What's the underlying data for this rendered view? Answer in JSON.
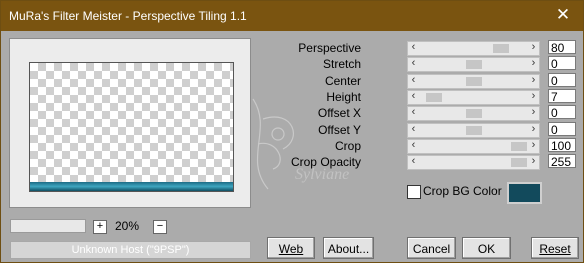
{
  "window": {
    "title": "MuRa's Filter Meister - Perspective Tiling 1.1",
    "close_icon": "close-icon"
  },
  "preview": {
    "zoom": "20%",
    "plus": "+",
    "minus": "−",
    "host_text": "Unknown Host (\"9PSP\")"
  },
  "params": [
    {
      "label": "Perspective",
      "value": "80",
      "level": 0.8
    },
    {
      "label": "Stretch",
      "value": "0",
      "level": 0.5
    },
    {
      "label": "Center",
      "value": "0",
      "level": 0.5
    },
    {
      "label": "Height",
      "value": "7",
      "level": 0.07
    },
    {
      "label": "Offset X",
      "value": "0",
      "level": 0.5
    },
    {
      "label": "Offset Y",
      "value": "0",
      "level": 0.5
    },
    {
      "label": "Crop",
      "value": "100",
      "level": 1.0
    },
    {
      "label": "Crop Opacity",
      "value": "255",
      "level": 1.0
    }
  ],
  "crop_bg": {
    "label": "Crop BG Color",
    "checked": false,
    "color": "#124a5c"
  },
  "watermark": "Sylviane",
  "buttons": {
    "web": "Web",
    "about": "About...",
    "cancel": "Cancel",
    "ok": "OK",
    "reset": "Reset"
  }
}
